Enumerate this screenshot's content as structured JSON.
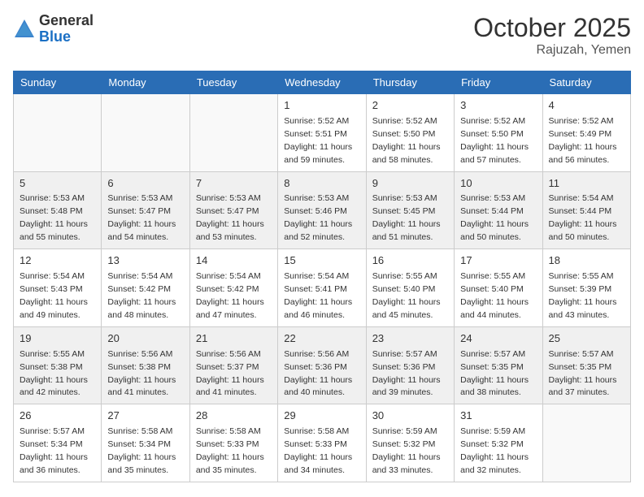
{
  "header": {
    "logo_general": "General",
    "logo_blue": "Blue",
    "month": "October 2025",
    "location": "Rajuzah, Yemen"
  },
  "weekdays": [
    "Sunday",
    "Monday",
    "Tuesday",
    "Wednesday",
    "Thursday",
    "Friday",
    "Saturday"
  ],
  "weeks": [
    [
      {
        "day": "",
        "sunrise": "",
        "sunset": "",
        "daylight": ""
      },
      {
        "day": "",
        "sunrise": "",
        "sunset": "",
        "daylight": ""
      },
      {
        "day": "",
        "sunrise": "",
        "sunset": "",
        "daylight": ""
      },
      {
        "day": "1",
        "sunrise": "Sunrise: 5:52 AM",
        "sunset": "Sunset: 5:51 PM",
        "daylight": "Daylight: 11 hours and 59 minutes."
      },
      {
        "day": "2",
        "sunrise": "Sunrise: 5:52 AM",
        "sunset": "Sunset: 5:50 PM",
        "daylight": "Daylight: 11 hours and 58 minutes."
      },
      {
        "day": "3",
        "sunrise": "Sunrise: 5:52 AM",
        "sunset": "Sunset: 5:50 PM",
        "daylight": "Daylight: 11 hours and 57 minutes."
      },
      {
        "day": "4",
        "sunrise": "Sunrise: 5:52 AM",
        "sunset": "Sunset: 5:49 PM",
        "daylight": "Daylight: 11 hours and 56 minutes."
      }
    ],
    [
      {
        "day": "5",
        "sunrise": "Sunrise: 5:53 AM",
        "sunset": "Sunset: 5:48 PM",
        "daylight": "Daylight: 11 hours and 55 minutes."
      },
      {
        "day": "6",
        "sunrise": "Sunrise: 5:53 AM",
        "sunset": "Sunset: 5:47 PM",
        "daylight": "Daylight: 11 hours and 54 minutes."
      },
      {
        "day": "7",
        "sunrise": "Sunrise: 5:53 AM",
        "sunset": "Sunset: 5:47 PM",
        "daylight": "Daylight: 11 hours and 53 minutes."
      },
      {
        "day": "8",
        "sunrise": "Sunrise: 5:53 AM",
        "sunset": "Sunset: 5:46 PM",
        "daylight": "Daylight: 11 hours and 52 minutes."
      },
      {
        "day": "9",
        "sunrise": "Sunrise: 5:53 AM",
        "sunset": "Sunset: 5:45 PM",
        "daylight": "Daylight: 11 hours and 51 minutes."
      },
      {
        "day": "10",
        "sunrise": "Sunrise: 5:53 AM",
        "sunset": "Sunset: 5:44 PM",
        "daylight": "Daylight: 11 hours and 50 minutes."
      },
      {
        "day": "11",
        "sunrise": "Sunrise: 5:54 AM",
        "sunset": "Sunset: 5:44 PM",
        "daylight": "Daylight: 11 hours and 50 minutes."
      }
    ],
    [
      {
        "day": "12",
        "sunrise": "Sunrise: 5:54 AM",
        "sunset": "Sunset: 5:43 PM",
        "daylight": "Daylight: 11 hours and 49 minutes."
      },
      {
        "day": "13",
        "sunrise": "Sunrise: 5:54 AM",
        "sunset": "Sunset: 5:42 PM",
        "daylight": "Daylight: 11 hours and 48 minutes."
      },
      {
        "day": "14",
        "sunrise": "Sunrise: 5:54 AM",
        "sunset": "Sunset: 5:42 PM",
        "daylight": "Daylight: 11 hours and 47 minutes."
      },
      {
        "day": "15",
        "sunrise": "Sunrise: 5:54 AM",
        "sunset": "Sunset: 5:41 PM",
        "daylight": "Daylight: 11 hours and 46 minutes."
      },
      {
        "day": "16",
        "sunrise": "Sunrise: 5:55 AM",
        "sunset": "Sunset: 5:40 PM",
        "daylight": "Daylight: 11 hours and 45 minutes."
      },
      {
        "day": "17",
        "sunrise": "Sunrise: 5:55 AM",
        "sunset": "Sunset: 5:40 PM",
        "daylight": "Daylight: 11 hours and 44 minutes."
      },
      {
        "day": "18",
        "sunrise": "Sunrise: 5:55 AM",
        "sunset": "Sunset: 5:39 PM",
        "daylight": "Daylight: 11 hours and 43 minutes."
      }
    ],
    [
      {
        "day": "19",
        "sunrise": "Sunrise: 5:55 AM",
        "sunset": "Sunset: 5:38 PM",
        "daylight": "Daylight: 11 hours and 42 minutes."
      },
      {
        "day": "20",
        "sunrise": "Sunrise: 5:56 AM",
        "sunset": "Sunset: 5:38 PM",
        "daylight": "Daylight: 11 hours and 41 minutes."
      },
      {
        "day": "21",
        "sunrise": "Sunrise: 5:56 AM",
        "sunset": "Sunset: 5:37 PM",
        "daylight": "Daylight: 11 hours and 41 minutes."
      },
      {
        "day": "22",
        "sunrise": "Sunrise: 5:56 AM",
        "sunset": "Sunset: 5:36 PM",
        "daylight": "Daylight: 11 hours and 40 minutes."
      },
      {
        "day": "23",
        "sunrise": "Sunrise: 5:57 AM",
        "sunset": "Sunset: 5:36 PM",
        "daylight": "Daylight: 11 hours and 39 minutes."
      },
      {
        "day": "24",
        "sunrise": "Sunrise: 5:57 AM",
        "sunset": "Sunset: 5:35 PM",
        "daylight": "Daylight: 11 hours and 38 minutes."
      },
      {
        "day": "25",
        "sunrise": "Sunrise: 5:57 AM",
        "sunset": "Sunset: 5:35 PM",
        "daylight": "Daylight: 11 hours and 37 minutes."
      }
    ],
    [
      {
        "day": "26",
        "sunrise": "Sunrise: 5:57 AM",
        "sunset": "Sunset: 5:34 PM",
        "daylight": "Daylight: 11 hours and 36 minutes."
      },
      {
        "day": "27",
        "sunrise": "Sunrise: 5:58 AM",
        "sunset": "Sunset: 5:34 PM",
        "daylight": "Daylight: 11 hours and 35 minutes."
      },
      {
        "day": "28",
        "sunrise": "Sunrise: 5:58 AM",
        "sunset": "Sunset: 5:33 PM",
        "daylight": "Daylight: 11 hours and 35 minutes."
      },
      {
        "day": "29",
        "sunrise": "Sunrise: 5:58 AM",
        "sunset": "Sunset: 5:33 PM",
        "daylight": "Daylight: 11 hours and 34 minutes."
      },
      {
        "day": "30",
        "sunrise": "Sunrise: 5:59 AM",
        "sunset": "Sunset: 5:32 PM",
        "daylight": "Daylight: 11 hours and 33 minutes."
      },
      {
        "day": "31",
        "sunrise": "Sunrise: 5:59 AM",
        "sunset": "Sunset: 5:32 PM",
        "daylight": "Daylight: 11 hours and 32 minutes."
      },
      {
        "day": "",
        "sunrise": "",
        "sunset": "",
        "daylight": ""
      }
    ]
  ]
}
